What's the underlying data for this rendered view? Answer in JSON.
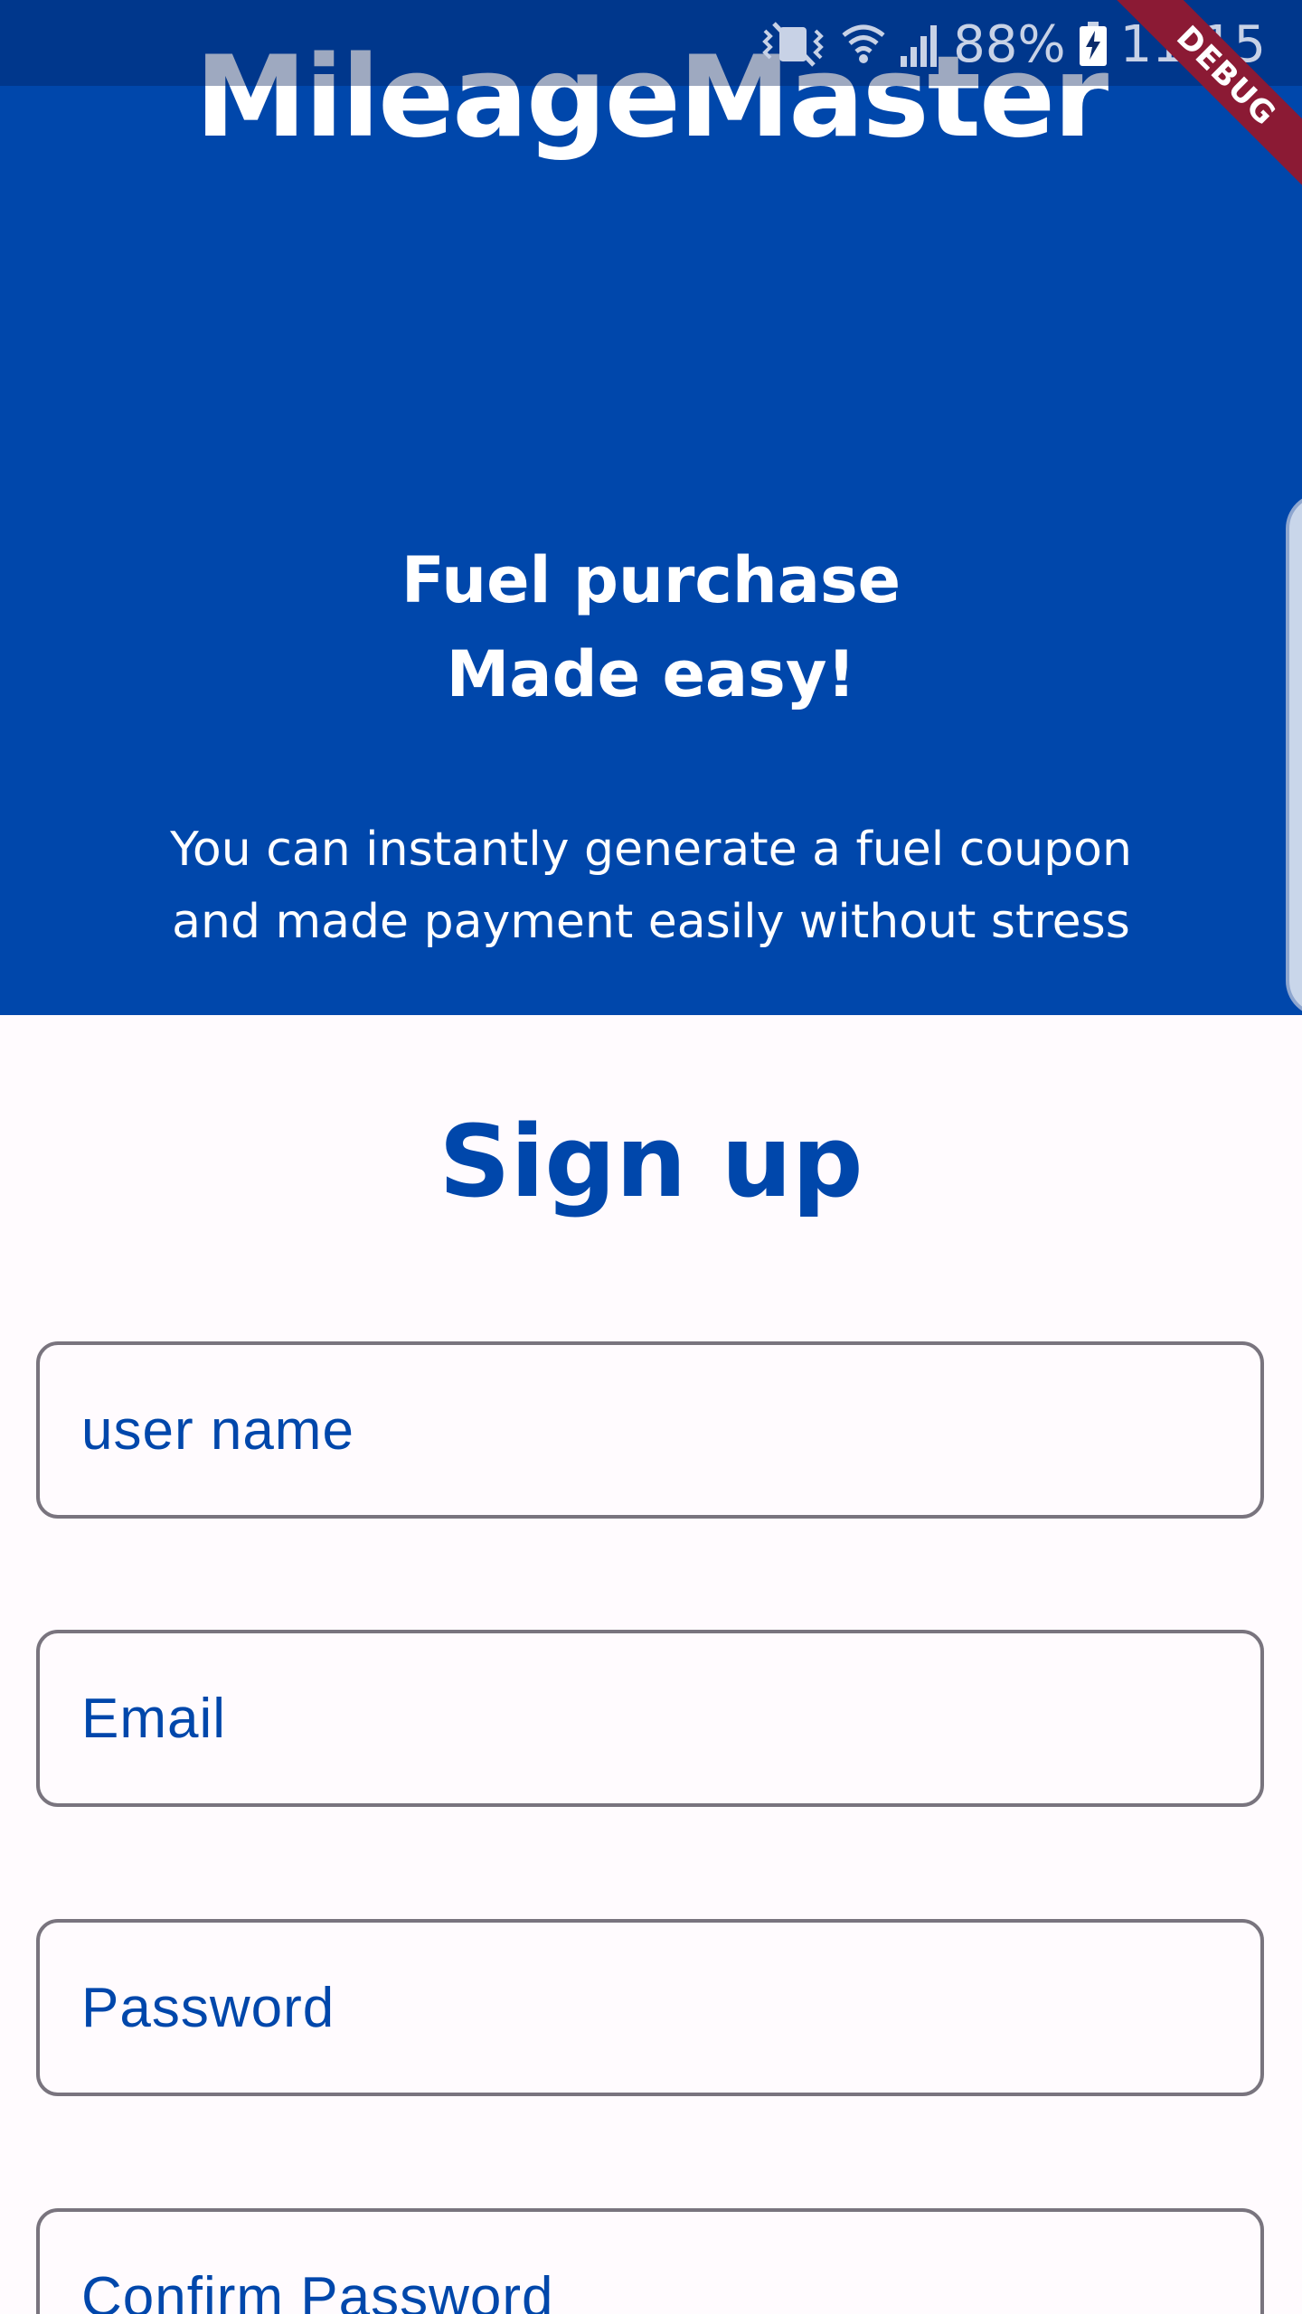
{
  "status_bar": {
    "battery": "88%",
    "time": "11:15",
    "icons": [
      "mute-vibrate-icon",
      "wifi-icon",
      "signal-icon",
      "battery-charging-icon"
    ]
  },
  "app": {
    "title": "MileageMaster",
    "debug_label": "DEBUG"
  },
  "hero": {
    "tagline_line1": "Fuel purchase",
    "tagline_line2": "Made easy!",
    "description_line1": "You can instantly generate a fuel coupon",
    "description_line2": "and made payment easily without stress"
  },
  "signup": {
    "title": "Sign up",
    "fields": [
      {
        "placeholder": "user name",
        "value": ""
      },
      {
        "placeholder": "Email",
        "value": ""
      },
      {
        "placeholder": "Password",
        "value": ""
      },
      {
        "placeholder": "Confirm Password",
        "value": ""
      }
    ]
  },
  "colors": {
    "primary": "#0047ab",
    "outline": "#79747e",
    "background": "#fffbfe",
    "debug_banner": "#8b1a34"
  }
}
